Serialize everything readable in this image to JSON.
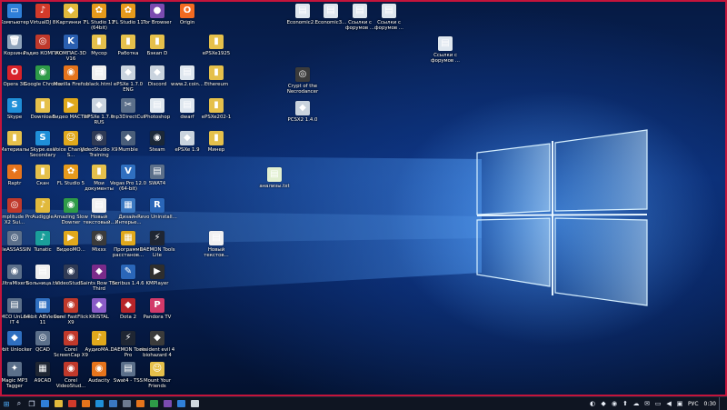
{
  "desktop_icons": [
    {
      "label": "Компьютер",
      "glyph": "▭",
      "color": "#2f7fd8",
      "icon": "computer-icon"
    },
    {
      "label": "VirtualDJ 8",
      "glyph": "♪",
      "color": "#d23a2a",
      "icon": "virtualdj-icon"
    },
    {
      "label": "Картинки 7",
      "glyph": "◆",
      "color": "#e1b93c",
      "icon": "folder-icon"
    },
    {
      "label": "FL Studio 11 (64bit)",
      "glyph": "✿",
      "color": "#e69a1c",
      "icon": "fl-studio-icon"
    },
    {
      "label": "FL Studio 11",
      "glyph": "✿",
      "color": "#e69a1c",
      "icon": "fl-studio-icon"
    },
    {
      "label": "Tor Browser",
      "glyph": "●",
      "color": "#7b4bb0",
      "icon": "tor-browser-icon"
    },
    {
      "label": "Origin",
      "glyph": "O",
      "color": "#f26a21",
      "icon": "origin-icon"
    },
    {
      "label": "Корзина",
      "glyph": "🗑",
      "color": "#8fa4bb",
      "icon": "recycle-bin-icon"
    },
    {
      "label": "Радио КОМПАС",
      "glyph": "◎",
      "color": "#c0392b",
      "icon": "radio-icon"
    },
    {
      "label": "КОМПАС-3D V16",
      "glyph": "K",
      "color": "#2a5fb0",
      "icon": "kompas-icon"
    },
    {
      "label": "Мусор",
      "glyph": "▮",
      "color": "#e5c04b",
      "icon": "folder-icon"
    },
    {
      "label": "Работка",
      "glyph": "▮",
      "color": "#e5c04b",
      "icon": "folder-icon"
    },
    {
      "label": "Бэкап D",
      "glyph": "▮",
      "color": "#e5c04b",
      "icon": "folder-icon"
    },
    {
      "label": "ePSXe1925",
      "glyph": "▮",
      "color": "#e5c04b",
      "icon": "folder-icon"
    },
    {
      "label": "Opera 38",
      "glyph": "O",
      "color": "#d8232a",
      "icon": "opera-icon"
    },
    {
      "label": "Google Chrome",
      "glyph": "◉",
      "color": "#2e9b48",
      "icon": "chrome-icon"
    },
    {
      "label": "Mozilla Firefox",
      "glyph": "◉",
      "color": "#e6741c",
      "icon": "firefox-icon"
    },
    {
      "label": "black.html",
      "glyph": "▤",
      "color": "#f0f0f0",
      "icon": "html-file-icon"
    },
    {
      "label": "ePSXe 1.7.0 ENG",
      "glyph": "◆",
      "color": "#c9d3de",
      "icon": "gamepad-icon"
    },
    {
      "label": "Discord",
      "glyph": "◆",
      "color": "#c9d3de",
      "icon": "gamepad-icon"
    },
    {
      "label": "www.2.coin...",
      "glyph": "▤",
      "color": "#dfe7ef",
      "icon": "file-icon"
    },
    {
      "label": "Ethereum",
      "glyph": "▮",
      "color": "#e5c04b",
      "icon": "folder-icon"
    },
    {
      "label": "Skype",
      "glyph": "S",
      "color": "#1f8fd8",
      "icon": "skype-icon"
    },
    {
      "label": "Download",
      "glyph": "▮",
      "color": "#e5c04b",
      "icon": "folder-icon"
    },
    {
      "label": "Видео МАСТЕР",
      "glyph": "▶",
      "color": "#e0a81c",
      "icon": "video-master-icon"
    },
    {
      "label": "ePSXe 1.7.0 RUS",
      "glyph": "◆",
      "color": "#c9d3de",
      "icon": "gamepad-icon"
    },
    {
      "label": "mp3DirectCut",
      "glyph": "✂",
      "color": "#5b6f8a",
      "icon": "mp3-icon"
    },
    {
      "label": "Photoshop",
      "glyph": "▤",
      "color": "#dfe7ef",
      "icon": "file-icon"
    },
    {
      "label": "dwarf",
      "glyph": "▤",
      "color": "#dfe7ef",
      "icon": "file-icon"
    },
    {
      "label": "ePSXe202-1",
      "glyph": "▮",
      "color": "#e5c04b",
      "icon": "folder-icon"
    },
    {
      "label": "Материалы",
      "glyph": "▮",
      "color": "#e5c04b",
      "icon": "folder-icon"
    },
    {
      "label": "Skype.exe Secondary",
      "glyph": "S",
      "color": "#1f8fd8",
      "icon": "skype-icon"
    },
    {
      "label": "Voice Changer S...",
      "glyph": "☺",
      "color": "#e0a81c",
      "icon": "voice-changer-icon"
    },
    {
      "label": "VideoStudio X9 Training",
      "glyph": "◉",
      "color": "#2f3a55",
      "icon": "videostudio-icon"
    },
    {
      "label": "Mumble",
      "glyph": "◆",
      "color": "#4a5e7a",
      "icon": "mumble-icon"
    },
    {
      "label": "Steam",
      "glyph": "◉",
      "color": "#1b2838",
      "icon": "steam-icon"
    },
    {
      "label": "ePSXe 1.9",
      "glyph": "◆",
      "color": "#c9d3de",
      "icon": "gamepad-icon"
    },
    {
      "label": "Минер",
      "glyph": "▮",
      "color": "#e5c04b",
      "icon": "folder-icon"
    },
    {
      "label": "Raptr",
      "glyph": "✦",
      "color": "#e6741c",
      "icon": "raptr-icon"
    },
    {
      "label": "Скан",
      "glyph": "▮",
      "color": "#e5c04b",
      "icon": "folder-icon"
    },
    {
      "label": "FL Studio 5",
      "glyph": "✿",
      "color": "#e69a1c",
      "icon": "fl-studio-icon"
    },
    {
      "label": "Мои документы",
      "glyph": "▮",
      "color": "#e5c04b",
      "icon": "folder-icon"
    },
    {
      "label": "Vegas Pro 12.0 (64-bit)",
      "glyph": "V",
      "color": "#2f6fc0",
      "icon": "vegas-icon"
    },
    {
      "label": "SWAT4",
      "glyph": "▤",
      "color": "#5b6f8a",
      "icon": "swat-icon"
    },
    {
      "label": "Samplitude Pro X2 Sui...",
      "glyph": "◎",
      "color": "#c0392b",
      "icon": "samplitude-icon"
    },
    {
      "label": "Audiggle",
      "glyph": "♪",
      "color": "#e1b93c",
      "icon": "audiggle-icon"
    },
    {
      "label": "Amazing Slow Downer",
      "glyph": "◉",
      "color": "#2e9b48",
      "icon": "slowdowner-icon"
    },
    {
      "label": "Новый текстовый...",
      "glyph": "▤",
      "color": "#f0f0f0",
      "icon": "text-file-icon"
    },
    {
      "label": "Дизайн Интерье...",
      "glyph": "▦",
      "color": "#3a78c2",
      "icon": "design-icon"
    },
    {
      "label": "Revo Uninstall...",
      "glyph": "R",
      "color": "#2a66b8",
      "icon": "revo-icon"
    },
    {
      "label": "FileASSASSIN",
      "glyph": "◎",
      "color": "#5b6f8a",
      "icon": "fileassassin-icon"
    },
    {
      "label": "Tunatic",
      "glyph": "♪",
      "color": "#1a9e9a",
      "icon": "tunatic-icon"
    },
    {
      "label": "ВидеоМО...",
      "glyph": "▶",
      "color": "#e0a81c",
      "icon": "video-icon"
    },
    {
      "label": "Mixxx",
      "glyph": "◉",
      "color": "#3b3b3b",
      "icon": "mixxx-icon"
    },
    {
      "label": "Программа расстанов...",
      "glyph": "▦",
      "color": "#e0a81c",
      "icon": "program-icon"
    },
    {
      "label": "DAEMON Tools Lite",
      "glyph": "⚡",
      "color": "#1f2633",
      "icon": "daemon-tools-icon"
    },
    {
      "label": "Новый текстов...",
      "glyph": "▤",
      "color": "#f0f0f0",
      "icon": "text-file-icon"
    },
    {
      "label": "UltraMixer5",
      "glyph": "◉",
      "color": "#5b6f8a",
      "icon": "ultramixer-icon"
    },
    {
      "label": "Больница.txt",
      "glyph": "▤",
      "color": "#f0f0f0",
      "icon": "text-file-icon"
    },
    {
      "label": "VideoStudi...",
      "glyph": "◉",
      "color": "#2f3a55",
      "icon": "videostudio-icon"
    },
    {
      "label": "Saints Row The Third",
      "glyph": "◆",
      "color": "#7a2b8a",
      "icon": "saints-row-icon"
    },
    {
      "label": "Scribus 1.4.6",
      "glyph": "✎",
      "color": "#2a66b8",
      "icon": "scribus-icon"
    },
    {
      "label": "KMPlayer",
      "glyph": "▶",
      "color": "#2e2e2e",
      "icon": "kmplayer-icon"
    },
    {
      "label": "EMCO UnLock IT 4",
      "glyph": "▤",
      "color": "#5b6f8a",
      "icon": "emco-icon"
    },
    {
      "label": "64 bit ABViewer 11",
      "glyph": "▦",
      "color": "#2f6fc0",
      "icon": "abviewer-icon"
    },
    {
      "label": "Corel FastFlick X9",
      "glyph": "◉",
      "color": "#c0392b",
      "icon": "corel-icon"
    },
    {
      "label": "KRISTAL",
      "glyph": "◆",
      "color": "#8a5cc7",
      "icon": "kristal-icon"
    },
    {
      "label": "Dota 2",
      "glyph": "◆",
      "color": "#b8252a",
      "icon": "dota-icon"
    },
    {
      "label": "Pandora TV",
      "glyph": "P",
      "color": "#d23a6a",
      "icon": "pandora-icon"
    },
    {
      "label": "IObit Unlocker",
      "glyph": "◆",
      "color": "#2f6fc0",
      "icon": "iobit-icon"
    },
    {
      "label": "QCAD",
      "glyph": "◎",
      "color": "#5b6f8a",
      "icon": "qcad-icon"
    },
    {
      "label": "Corel ScreenCap X9",
      "glyph": "◉",
      "color": "#c0392b",
      "icon": "corel-icon"
    },
    {
      "label": "АудиоМА...",
      "glyph": "♪",
      "color": "#e0a81c",
      "icon": "audio-icon"
    },
    {
      "label": "DAEMON Tools Pro",
      "glyph": "⚡",
      "color": "#1f2633",
      "icon": "daemon-tools-icon"
    },
    {
      "label": "resident evil 4 biohazard 4",
      "glyph": "◆",
      "color": "#3b3b3b",
      "icon": "resident-evil-icon"
    },
    {
      "label": "Magic MP3 Tagger",
      "glyph": "✦",
      "color": "#5b6f8a",
      "icon": "mp3-tagger-icon"
    },
    {
      "label": "A9CAD",
      "glyph": "▦",
      "color": "#1f2633",
      "icon": "a9cad-icon"
    },
    {
      "label": "Corel VideoStud...",
      "glyph": "◉",
      "color": "#c0392b",
      "icon": "corel-icon"
    },
    {
      "label": "Audacity",
      "glyph": "◉",
      "color": "#e6741c",
      "icon": "audacity-icon"
    },
    {
      "label": "Swat4 - TSS",
      "glyph": "▤",
      "color": "#5b6f8a",
      "icon": "swat-icon"
    },
    {
      "label": "Mount Your Friends",
      "glyph": "☺",
      "color": "#e5c04b",
      "icon": "mount-friends-icon"
    },
    {
      "label": "Economic2...",
      "glyph": "▤",
      "color": "#dfe7ef",
      "icon": "file-icon"
    },
    {
      "label": "Economic3...",
      "glyph": "▤",
      "color": "#dfe7ef",
      "icon": "file-icon"
    },
    {
      "label": "Ссылки с форумов ...",
      "glyph": "▤",
      "color": "#dfe7ef",
      "icon": "file-icon"
    },
    {
      "label": "Ссылки с форумов ...",
      "glyph": "▤",
      "color": "#dfe7ef",
      "icon": "file-icon"
    },
    {
      "label": "Ссылки с форумов ...",
      "glyph": "▤",
      "color": "#dfe7ef",
      "icon": "file-icon"
    },
    {
      "label": "Crypt of the Necrodancer",
      "glyph": "◎",
      "color": "#3b3b3b",
      "icon": "crypt-icon"
    },
    {
      "label": "PCSX2 1.4.0",
      "glyph": "◆",
      "color": "#c9d3de",
      "icon": "gamepad-icon"
    },
    {
      "label": "анализы.txt",
      "glyph": "▤",
      "color": "#e1efd0",
      "icon": "text-file-icon"
    }
  ],
  "taskbar": {
    "start_glyph": "⊞",
    "search_glyph": "⌕",
    "taskview_glyph": "❐",
    "pinned": [
      {
        "color": "#2f7fd8",
        "name": "edge"
      },
      {
        "color": "#e1b93c",
        "name": "explorer"
      },
      {
        "color": "#d23a2a",
        "name": "app-red"
      },
      {
        "color": "#e6741c",
        "name": "firefox"
      },
      {
        "color": "#1f8fd8",
        "name": "skype"
      },
      {
        "color": "#3a78c2",
        "name": "app-blue"
      },
      {
        "color": "#6d7a8f",
        "name": "app-grey"
      },
      {
        "color": "#e6741c",
        "name": "app-orange"
      },
      {
        "color": "#2e9b48",
        "name": "chrome"
      },
      {
        "color": "#7b4bb0",
        "name": "app-purple"
      },
      {
        "color": "#2f7fd8",
        "name": "app-blue-2"
      },
      {
        "color": "#d0d8e0",
        "name": "app-white"
      }
    ],
    "tray_icons": [
      "◐",
      "◆",
      "◉",
      "⬆",
      "☁",
      "✉",
      "▭",
      "◀",
      "▣"
    ],
    "language": "РУС",
    "clock": "0:30"
  }
}
